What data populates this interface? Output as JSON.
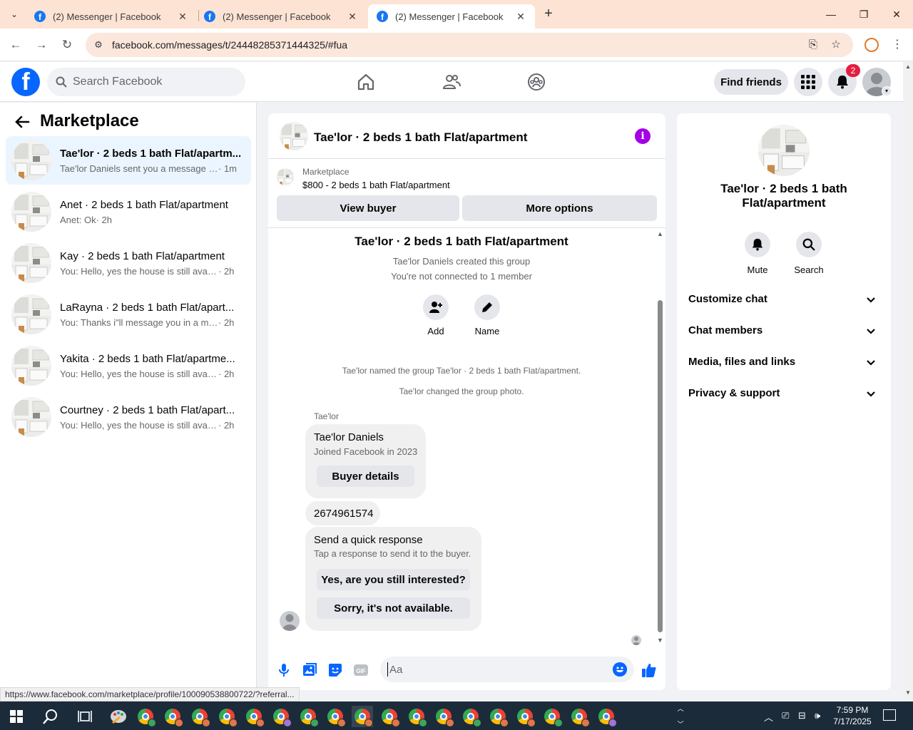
{
  "browser": {
    "tabs": [
      {
        "title": "(2) Messenger | Facebook",
        "active": false
      },
      {
        "title": "(2) Messenger | Facebook",
        "active": false
      },
      {
        "title": "(2) Messenger | Facebook",
        "active": true
      }
    ],
    "url": "facebook.com/messages/t/24448285371444325/#fua",
    "status_url": "https://www.facebook.com/marketplace/profile/100090538800722/?referral..."
  },
  "header": {
    "search_placeholder": "Search Facebook",
    "find_friends_label": "Find friends",
    "notification_count": "2",
    "brand_color": "#0866ff"
  },
  "sidebar": {
    "title": "Marketplace",
    "conversations": [
      {
        "title": "Tae'lor · 2 beds 1 bath Flat/apartm...",
        "preview": "Tae'lor Daniels sent you a message a...",
        "time": "· 1m",
        "unread": true,
        "selected": true
      },
      {
        "title": "Anet · 2 beds 1 bath Flat/apartment",
        "preview": "Anet: Ok",
        "time": "· 2h",
        "unread": false,
        "selected": false
      },
      {
        "title": "Kay · 2 beds 1 bath Flat/apartment",
        "preview": "You: Hello, yes the house is still availa...",
        "time": "· 2h",
        "unread": false,
        "selected": false
      },
      {
        "title": "LaRayna · 2 beds 1 bath Flat/apart...",
        "preview": "You: Thanks i\"ll message you in a mo...",
        "time": "· 2h",
        "unread": false,
        "selected": false
      },
      {
        "title": "Yakita · 2 beds 1 bath Flat/apartme...",
        "preview": "You: Hello, yes the house is still availa...",
        "time": "· 2h",
        "unread": false,
        "selected": false
      },
      {
        "title": "Courtney · 2 beds 1 bath Flat/apart...",
        "preview": "You: Hello, yes the house is still availa...",
        "time": "· 2h",
        "unread": false,
        "selected": false
      }
    ]
  },
  "chat": {
    "title": "Tae'lor · 2 beds 1 bath Flat/apartment",
    "marketplace_label": "Marketplace",
    "listing": "$800 - 2 beds 1 bath Flat/apartment",
    "view_buyer_label": "View buyer",
    "more_options_label": "More options",
    "group_title": "Tae'lor · 2 beds 1 bath Flat/apartment",
    "created_text": "Tae'lor Daniels created this group",
    "not_connected_text": "You're not connected to 1 member",
    "add_label": "Add",
    "name_label": "Name",
    "system_named": "Tae'lor named the group Tae'lor · 2 beds 1 bath Flat/apartment.",
    "system_photo": "Tae'lor changed the group photo.",
    "sender": "Tae'lor",
    "buyer_card": {
      "name": "Tae'lor Daniels",
      "joined": "Joined Facebook in 2023",
      "button": "Buyer details"
    },
    "phone_message": "2674961574",
    "quick_response": {
      "title": "Send a quick response",
      "subtitle": "Tap a response to send it to the buyer.",
      "option1": "Yes, are you still interested?",
      "option2": "Sorry, it's not available."
    },
    "composer_placeholder": "Aa",
    "accent_color": "#0866ff",
    "info_color": "#a300e6"
  },
  "details": {
    "title": "Tae'lor · 2 beds 1 bath Flat/apartment",
    "mute_label": "Mute",
    "search_label": "Search",
    "sections": [
      "Customize chat",
      "Chat members",
      "Media, files and links",
      "Privacy & support"
    ]
  },
  "taskbar": {
    "time": "7:59 PM",
    "date": "7/17/2025"
  }
}
